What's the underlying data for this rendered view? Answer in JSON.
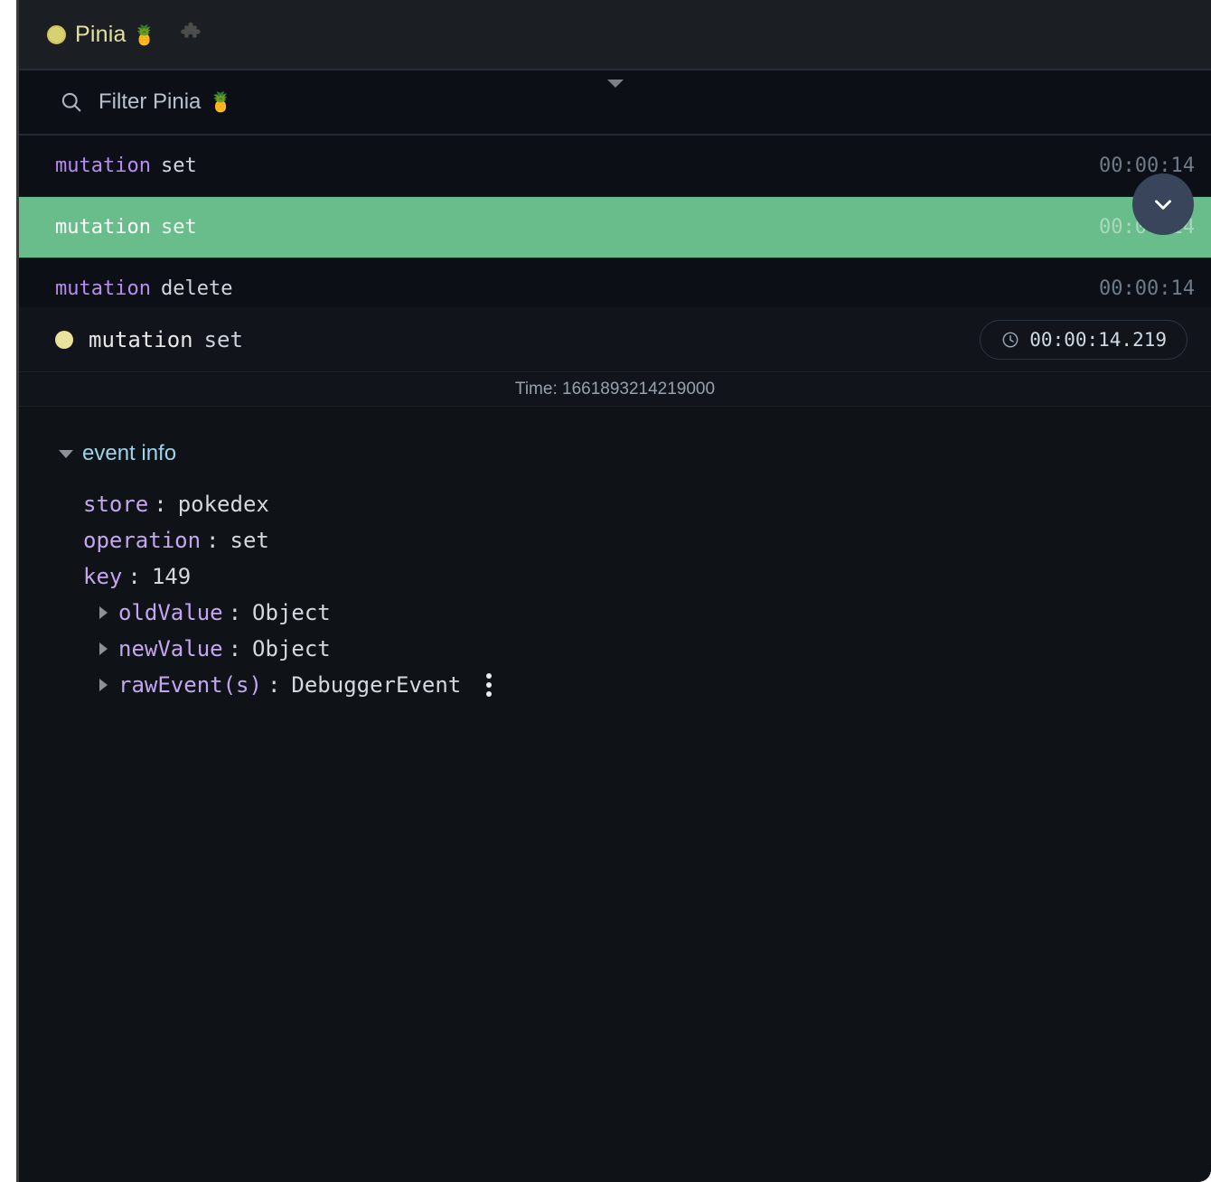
{
  "titlebar": {
    "status_dot": "yellow-status-dot",
    "app_title": "Pinia",
    "app_emoji": "🍍",
    "extension_icon": "puzzle-piece-icon",
    "dot_color": "#d8d173",
    "title_color": "#e4e09a"
  },
  "filter": {
    "icon": "search-icon",
    "placeholder": "Filter Pinia",
    "emoji": "🍍",
    "value": "",
    "splitter": "splitter-triangle"
  },
  "events": [
    {
      "type": "mutation",
      "operation": "set",
      "time": "00:00:14",
      "selected": false
    },
    {
      "type": "mutation",
      "operation": "set",
      "time": "00:00:14",
      "selected": true
    },
    {
      "type": "mutation",
      "operation": "delete",
      "time": "00:00:14",
      "selected": false
    }
  ],
  "scroll_button": {
    "icon": "chevron-down-icon",
    "color": "#39455a"
  },
  "selection_color": "#69bd8b",
  "detail": {
    "dot": "yellow-event-dot",
    "type": "mutation",
    "operation": "set",
    "badge_icon": "clock-icon",
    "badge_time": "00:00:14.219",
    "time_label": "Time: 1661893214219000"
  },
  "inspector": {
    "section_label": "event info",
    "rows": [
      {
        "key": "store",
        "value": "pokedex",
        "expandable": false,
        "menu": false
      },
      {
        "key": "operation",
        "value": "set",
        "expandable": false,
        "menu": false
      },
      {
        "key": "key",
        "value": "149",
        "expandable": false,
        "menu": false
      },
      {
        "key": "oldValue",
        "value": "Object",
        "expandable": true,
        "menu": false
      },
      {
        "key": "newValue",
        "value": "Object",
        "expandable": true,
        "menu": false
      },
      {
        "key": "rawEvent(s)",
        "value": "DebuggerEvent",
        "expandable": true,
        "menu": true
      }
    ]
  }
}
